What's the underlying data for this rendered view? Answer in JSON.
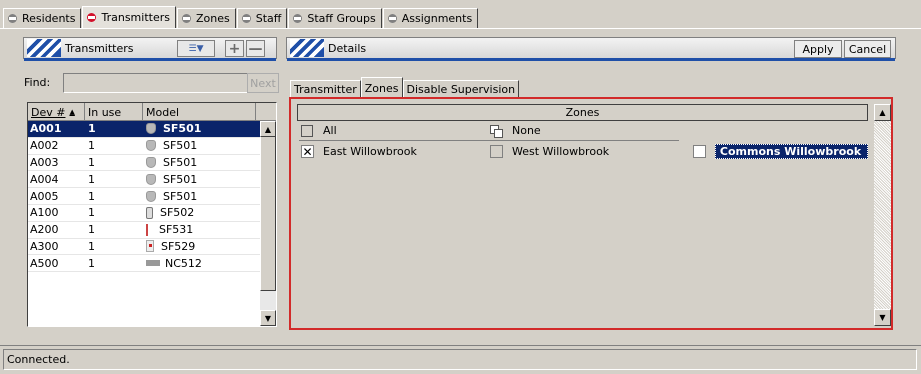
{
  "top_tabs": [
    {
      "label": "Residents",
      "active": false
    },
    {
      "label": "Transmitters",
      "active": true
    },
    {
      "label": "Zones",
      "active": false
    },
    {
      "label": "Staff",
      "active": false
    },
    {
      "label": "Staff Groups",
      "active": false
    },
    {
      "label": "Assignments",
      "active": false
    }
  ],
  "left_panel": {
    "title": "Transmitters",
    "find_label": "Find:",
    "find_value": "",
    "next_label": "Next",
    "columns": [
      "Dev #",
      "In use",
      "Model"
    ],
    "rows": [
      {
        "dev": "A001",
        "inuse": "1",
        "model": "SF501",
        "icon": "sf501-device-icon",
        "selected": true
      },
      {
        "dev": "A002",
        "inuse": "1",
        "model": "SF501",
        "icon": "sf501-device-icon"
      },
      {
        "dev": "A003",
        "inuse": "1",
        "model": "SF501",
        "icon": "sf501-device-icon"
      },
      {
        "dev": "A004",
        "inuse": "1",
        "model": "SF501",
        "icon": "sf501-device-icon"
      },
      {
        "dev": "A005",
        "inuse": "1",
        "model": "SF501",
        "icon": "sf501-device-icon"
      },
      {
        "dev": "A100",
        "inuse": "1",
        "model": "SF502",
        "icon": "sf502-device-icon"
      },
      {
        "dev": "A200",
        "inuse": "1",
        "model": "SF531",
        "icon": "sf531-device-icon"
      },
      {
        "dev": "A300",
        "inuse": "1",
        "model": "SF529",
        "icon": "sf529-device-icon"
      },
      {
        "dev": "A500",
        "inuse": "1",
        "model": "NC512",
        "icon": "nc512-device-icon"
      }
    ]
  },
  "right_panel": {
    "title": "Details",
    "apply_label": "Apply",
    "cancel_label": "Cancel",
    "sub_tabs": [
      "Transmitter",
      "Zones",
      "Disable Supervision"
    ],
    "active_sub_tab": "Zones",
    "zones_header": "Zones",
    "all_label": "All",
    "none_label": "None",
    "zones": [
      {
        "label": "East Willowbrook",
        "checked": true
      },
      {
        "label": "West Willowbrook",
        "checked": false
      },
      {
        "label": "Commons Willowbrook",
        "checked": false,
        "selected": true
      }
    ]
  },
  "status": "Connected.",
  "colors": {
    "selection": "#0a246a",
    "accent_blue": "#1f4fa8",
    "active_tab_bullet": "#d2102a",
    "zones_border": "#d22a2a"
  }
}
